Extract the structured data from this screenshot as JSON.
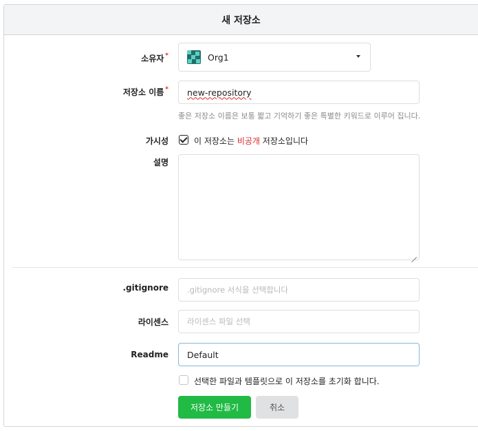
{
  "header": {
    "title": "새 저장소"
  },
  "owner": {
    "label": "소유자",
    "required_mark": "*",
    "value": "Org1"
  },
  "repo_name": {
    "label": "저장소 이름",
    "required_mark": "*",
    "value": "new-repository",
    "hint": "좋은 저장소 이름은 보통 짧고 기억하기 좋은 특별한 키워드로 이루어 집니다."
  },
  "visibility": {
    "label": "가시성",
    "checked": true,
    "text_prefix": "이 저장소는 ",
    "text_private": "비공개",
    "text_suffix": " 저장소입니다"
  },
  "description": {
    "label": "설명",
    "value": ""
  },
  "gitignore": {
    "label": ".gitignore",
    "placeholder": ".gitignore 서식을 선택합니다"
  },
  "license": {
    "label": "라이센스",
    "placeholder": "라이센스 파일 선택"
  },
  "readme": {
    "label": "Readme",
    "value": "Default"
  },
  "auto_init": {
    "checked": false,
    "text": "선택한 파일과 템플릿으로 이 저장소를 초기화 합니다."
  },
  "buttons": {
    "create": "저장소 만들기",
    "cancel": "취소"
  },
  "colors": {
    "primary_green": "#21ba45",
    "required_red": "#db2828",
    "focus_blue": "#85b7d9"
  }
}
